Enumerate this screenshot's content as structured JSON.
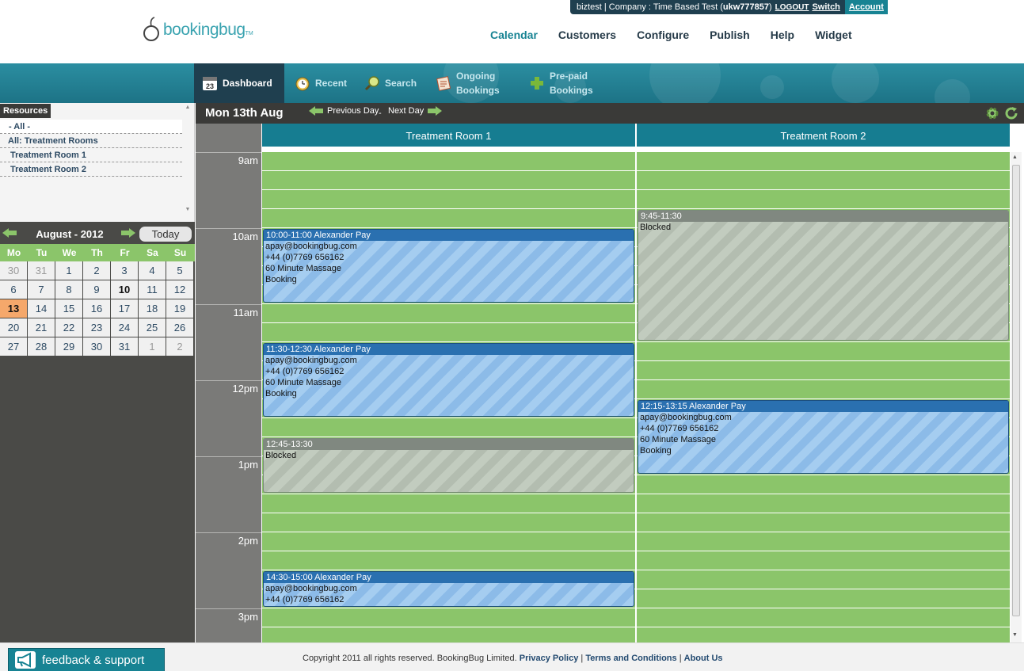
{
  "brand": {
    "logo_text": "bookingbug",
    "logo_tm": "TM"
  },
  "account_bar": {
    "user": "biztest",
    "company_label": "Company : Time Based Test",
    "company_id": "ukw777857",
    "logout": "LOGOUT",
    "switch": "Switch",
    "account": "Account"
  },
  "main_nav": [
    {
      "label": "Calendar",
      "active": true
    },
    {
      "label": "Customers",
      "active": false
    },
    {
      "label": "Configure",
      "active": false
    },
    {
      "label": "Publish",
      "active": false
    },
    {
      "label": "Help",
      "active": false
    },
    {
      "label": "Widget",
      "active": false
    }
  ],
  "tabs": {
    "dashboard": "Dashboard",
    "dashboard_icon_num": "23",
    "recent": "Recent",
    "search": "Search",
    "ongoing_1": "Ongoing",
    "ongoing_2": "Bookings",
    "prepaid_1": "Pre-paid",
    "prepaid_2": "Bookings"
  },
  "resources": {
    "header": "Resources",
    "items": [
      "- All -",
      "All: Treatment Rooms",
      "Treatment Room 1",
      "Treatment Room 2"
    ]
  },
  "mini_calendar": {
    "month_label": "August - 2012",
    "today_button": "Today",
    "days_of_week": [
      "Mo",
      "Tu",
      "We",
      "Th",
      "Fr",
      "Sa",
      "Su"
    ],
    "weeks": [
      [
        "30",
        "31",
        "1",
        "2",
        "3",
        "4",
        "5"
      ],
      [
        "6",
        "7",
        "8",
        "9",
        "10",
        "11",
        "12"
      ],
      [
        "13",
        "14",
        "15",
        "16",
        "17",
        "18",
        "19"
      ],
      [
        "20",
        "21",
        "22",
        "23",
        "24",
        "25",
        "26"
      ],
      [
        "27",
        "28",
        "29",
        "30",
        "31",
        "1",
        "2"
      ]
    ],
    "selected_day": "13",
    "bold_day": "10"
  },
  "day_view": {
    "date": "Mon 13th Aug",
    "previous_day": "Previous Day",
    "separator": "-",
    "next_day": "Next Day",
    "rooms": [
      "Treatment Room 1",
      "Treatment Room 2"
    ],
    "hours": [
      "9am",
      "10am",
      "11am",
      "12pm",
      "1pm",
      "2pm",
      "3pm"
    ]
  },
  "events": [
    {
      "room": 0,
      "type": "booking",
      "header": "10:00-11:00 Alexander Pay",
      "lines": [
        "apay@bookingbug.com",
        "+44 (0)7769 656162",
        "60 Minute Massage",
        "Booking"
      ]
    },
    {
      "room": 0,
      "type": "booking",
      "header": "11:30-12:30 Alexander Pay",
      "lines": [
        "apay@bookingbug.com",
        "+44 (0)7769 656162",
        "60 Minute Massage",
        "Booking"
      ]
    },
    {
      "room": 0,
      "type": "blocked",
      "header": "12:45-13:30",
      "lines": [
        "Blocked"
      ]
    },
    {
      "room": 0,
      "type": "booking",
      "header": "14:30-15:00 Alexander Pay",
      "lines": [
        "apay@bookingbug.com",
        "+44 (0)7769 656162"
      ]
    },
    {
      "room": 1,
      "type": "blocked",
      "header": "9:45-11:30",
      "lines": [
        "Blocked"
      ]
    },
    {
      "room": 1,
      "type": "booking",
      "header": "12:15-13:15 Alexander Pay",
      "lines": [
        "apay@bookingbug.com",
        "+44 (0)7769 656162",
        "60 Minute Massage",
        "Booking"
      ]
    }
  ],
  "footer": {
    "feedback": "feedback & support",
    "copyright": "Copyright 2011 all rights reserved. BookingBug Limited.",
    "privacy": "Privacy Policy",
    "terms": "Terms and Conditions",
    "about": "About Us",
    "divider": "|"
  },
  "colors": {
    "accent": "#178393",
    "slot_green": "#8bc56a",
    "booking_blue": "#2a70b0",
    "blocked_grey": "#808880",
    "selected_day": "#f5a86b"
  }
}
